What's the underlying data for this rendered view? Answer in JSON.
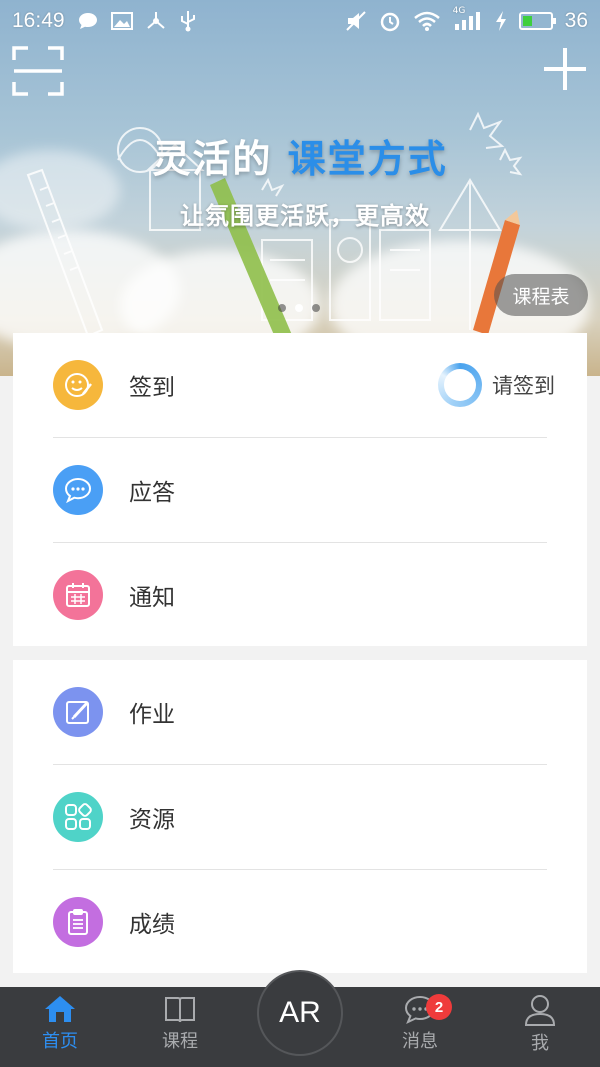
{
  "status_bar": {
    "time": "16:49",
    "battery_percent": "36",
    "network_type": "4G",
    "battery_level": 0.36,
    "icons": [
      "chat-bubble-icon",
      "image-icon",
      "share-icon",
      "usb-icon",
      "mute-icon",
      "alarm-icon",
      "wifi-icon",
      "signal-icon",
      "charging-icon",
      "battery-icon"
    ]
  },
  "header": {
    "scan_icon": "scan-icon",
    "add_icon": "plus-icon"
  },
  "banner": {
    "title_part1": "灵活的",
    "title_part2": "课堂方式",
    "subtitle": "让氛围更活跃，更高效",
    "schedule_button": "课程表",
    "slide_count": 3,
    "active_slide": 2,
    "highlight_color": "#2b8ee8"
  },
  "card1": {
    "items": [
      {
        "label": "签到",
        "icon": "smile-pen-icon",
        "color": "#f6b73c"
      },
      {
        "label": "应答",
        "icon": "chat-dots-icon",
        "color": "#4a9ff5"
      },
      {
        "label": "通知",
        "icon": "calendar-icon",
        "color": "#f37399"
      }
    ],
    "checkin_status": "请签到"
  },
  "card2": {
    "items": [
      {
        "label": "作业",
        "icon": "edit-icon",
        "color": "#7c93ef"
      },
      {
        "label": "资源",
        "icon": "grid-icon",
        "color": "#4fd3c8"
      },
      {
        "label": "成绩",
        "icon": "clipboard-icon",
        "color": "#c36ee0"
      }
    ]
  },
  "tabbar": {
    "tabs": [
      {
        "label": "首页",
        "icon": "home-icon",
        "active": true
      },
      {
        "label": "课程",
        "icon": "book-icon",
        "active": false
      },
      {
        "label": "消息",
        "icon": "message-icon",
        "active": false
      },
      {
        "label": "我",
        "icon": "user-icon",
        "active": false
      }
    ],
    "center_button": "AR",
    "message_badge": "2",
    "active_color": "#2d8ef0"
  }
}
